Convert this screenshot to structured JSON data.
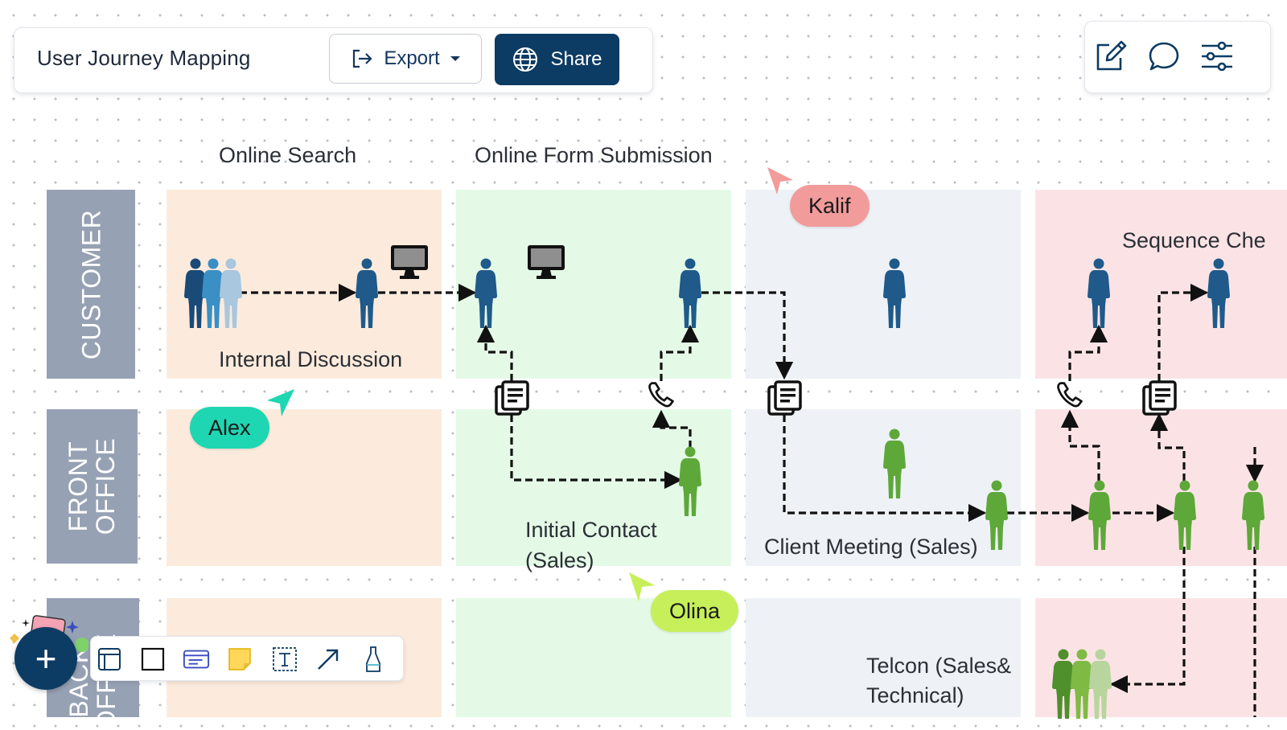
{
  "header": {
    "title": "User Journey Mapping",
    "export_label": "Export",
    "share_label": "Share"
  },
  "right_toolbar": {
    "icons": [
      "edit-icon",
      "comment-icon",
      "settings-sliders-icon"
    ]
  },
  "lanes": [
    "CUSTOMER",
    "FRONT\nOFFICE",
    "BACK\nOFFICE"
  ],
  "stage_titles": {
    "online_search": "Online Search",
    "online_form": "Online Form Submission",
    "sequence": "Sequence Che"
  },
  "cell_labels": {
    "internal_discussion": "Internal Discussion",
    "initial_contact_line1": "Initial Contact",
    "initial_contact_line2": "(Sales)",
    "client_meeting": "Client Meeting (Sales)",
    "telcon_line1": "Telcon (Sales&",
    "telcon_line2": "Technical)"
  },
  "collaborators": [
    {
      "name": "Kalif",
      "color": "#f29b9b"
    },
    {
      "name": "Alex",
      "color": "#1fd6b2"
    },
    {
      "name": "Olina",
      "color": "#c6ef5a"
    }
  ],
  "colors": {
    "customer_figure": "#1f5a8a",
    "office_figure": "#5ea83a",
    "lane_label": "#97a1b4",
    "stage_orange": "#fcebdc",
    "stage_green": "#e4fae6",
    "stage_grey": "#eef2f6",
    "stage_pink": "#fbe3e5"
  },
  "bottom_toolbar": {
    "add_label": "+",
    "tools": [
      "frame-icon",
      "rectangle-icon",
      "card-icon",
      "sticky-note-icon",
      "text-icon",
      "arrow-icon",
      "pen-icon"
    ]
  }
}
